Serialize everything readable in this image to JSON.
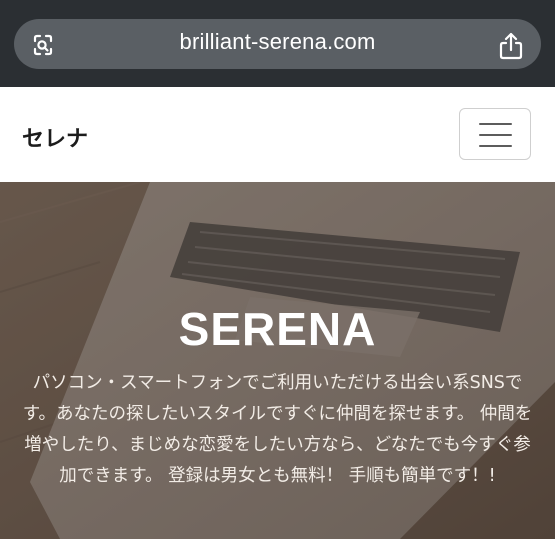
{
  "browser": {
    "url": "brilliant-serena.com",
    "left_icon": "page-settings-icon",
    "right_icon": "share-icon"
  },
  "header": {
    "brand": "セレナ",
    "menu_icon": "hamburger-menu-icon"
  },
  "hero": {
    "title": "SERENA",
    "description": "パソコン・スマートフォンでご利用いただける出会い系SNSです。あなたの探したいスタイルですぐに仲間を探せます。 仲間を増やしたり、まじめな恋愛をしたい方なら、どなたでも今すぐ参加できます。 登録は男女とも無料！ 手順も簡単です！!"
  },
  "colors": {
    "browser_bar": "#2b2f33",
    "url_pill": "#5a5f64",
    "hero_overlay": "#6b5b4f"
  }
}
